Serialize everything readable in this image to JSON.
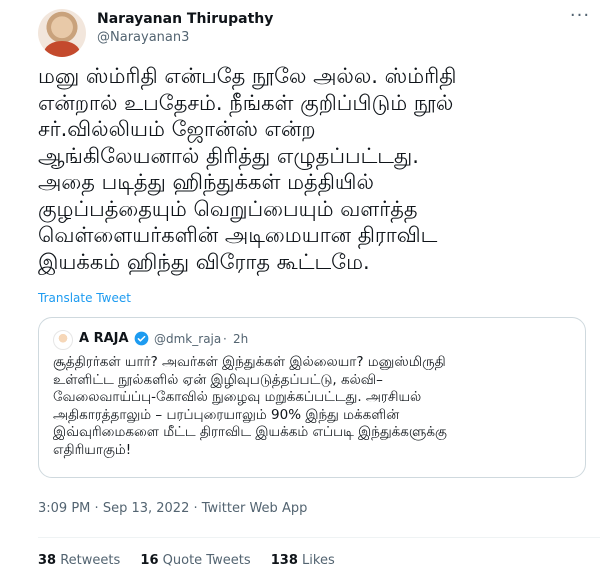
{
  "author": {
    "name": "Narayanan Thirupathy",
    "handle": "@Narayanan3"
  },
  "tweet": {
    "text": "மனு ஸ்ம்ரிதி என்பதே நூலே அல்ல. ஸ்ம்ரிதி\nஎன்றால் உபதேசம். நீங்கள் குறிப்பிடும் நூல்\nசர்.வில்லியம் ஜோன்ஸ் என்ற\nஆங்கிலேயனால் திரித்து எழுதப்பட்டது.\nஅதை படித்து  ஹிந்துக்கள் மத்தியில்\nகுழப்பத்தையும் வெறுப்பையும் வளர்த்த\nவெள்ளையர்களின் அடிமையான திராவிட\nஇயக்கம் ஹிந்து விரோத கூட்டமே.",
    "translate_label": "Translate Tweet"
  },
  "quote": {
    "name": "A RAJA",
    "handle": "@dmk_raja",
    "separator": "·",
    "time": "2h",
    "text": "சூத்திரர்கள் யார்? அவர்கள் இந்துக்கள் இல்லையா? மனுஸ்மிருதி\nஉள்ளிட்ட நூல்களில் ஏன் இழிவுபடுத்தப்பட்டு, கல்வி–\nவேலைவாய்ப்பு-கோவில் நுழைவு மறுக்கப்பட்டது. அரசியல்\nஅதிகாரத்தாலும் – பரப்புரையாலும் 90% இந்து மக்களின்\nஇவ்வுரிமைகளை மீட்ட திராவிட இயக்கம் எப்படி இந்துக்களுக்கு\nஎதிரியாகும்!"
  },
  "meta": {
    "time": "3:09 PM",
    "separator": "·",
    "date": "Sep 13, 2022",
    "source": "Twitter Web App"
  },
  "stats": {
    "retweets_count": "38",
    "retweets_label": "Retweets",
    "quotes_count": "16",
    "quotes_label": "Quote Tweets",
    "likes_count": "138",
    "likes_label": "Likes"
  },
  "colors": {
    "link": "#1d9bf0",
    "secondary_text": "#536471",
    "verified": "#1d9bf0"
  },
  "icons": [
    "more-icon",
    "verified-icon"
  ]
}
